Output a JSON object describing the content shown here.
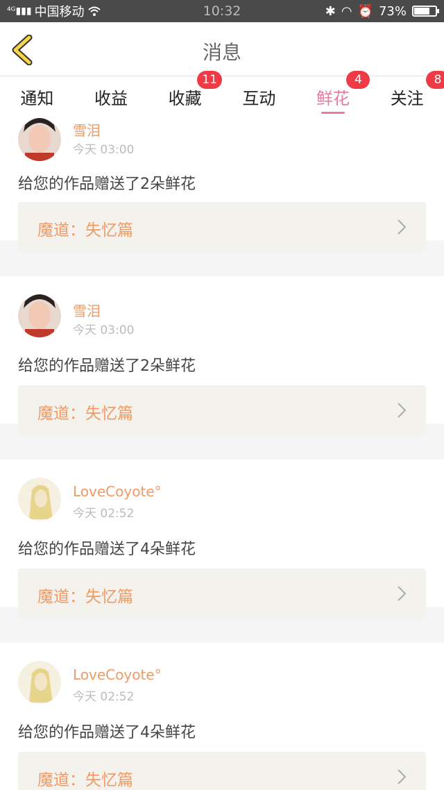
{
  "status_bar": {
    "carrier": "中国移动",
    "time": "10:32",
    "battery": "73%"
  },
  "header": {
    "title": "消息"
  },
  "tabs": [
    {
      "label": "通知",
      "badge": ""
    },
    {
      "label": "收益",
      "badge": ""
    },
    {
      "label": "收藏",
      "badge": "11"
    },
    {
      "label": "互动",
      "badge": ""
    },
    {
      "label": "鲜花",
      "badge": "4",
      "active": true
    },
    {
      "label": "关注",
      "badge": "8"
    }
  ],
  "messages": [
    {
      "user": "雪泪",
      "time": "今天 03:00",
      "text": "给您的作品赠送了2朵鲜花",
      "work": "魔道：失忆篇"
    },
    {
      "user": "雪泪",
      "time": "今天 03:00",
      "text": "给您的作品赠送了2朵鲜花",
      "work": "魔道：失忆篇"
    },
    {
      "user": "LoveCoyote°",
      "time": "今天 02:52",
      "text": "给您的作品赠送了4朵鲜花",
      "work": "魔道：失忆篇"
    },
    {
      "user": "LoveCoyote°",
      "time": "今天 02:52",
      "text": "给您的作品赠送了4朵鲜花",
      "work": "魔道：失忆篇"
    }
  ],
  "colors": {
    "accent": "#e979a4",
    "badge": "#ef3b45",
    "highlight": "#f09a66"
  }
}
